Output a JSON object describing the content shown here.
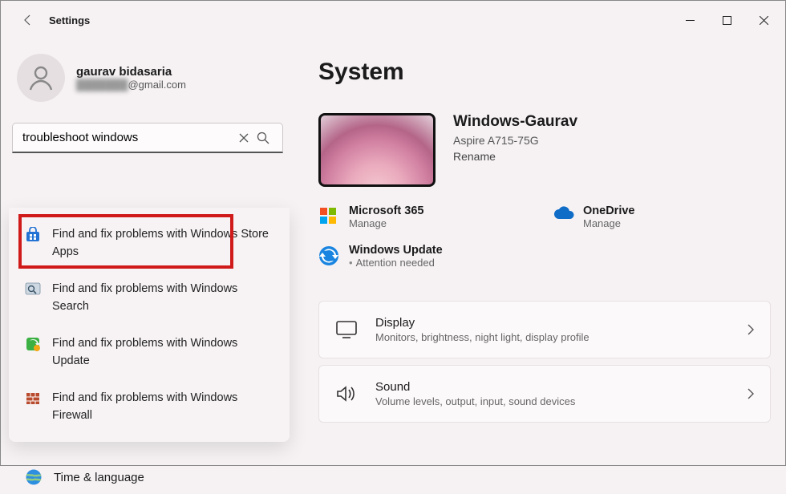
{
  "app_title": "Settings",
  "account": {
    "name": "gaurav bidasaria",
    "email_hidden": "███████",
    "email_domain": "@gmail.com"
  },
  "search": {
    "value": "troubleshoot windows"
  },
  "suggestions": [
    {
      "icon": "store-icon",
      "label": "Find and fix problems with Windows Store Apps"
    },
    {
      "icon": "search-fix-icon",
      "label": "Find and fix problems with Windows Search"
    },
    {
      "icon": "wu-fix-icon",
      "label": "Find and fix problems with Windows Update"
    },
    {
      "icon": "firewall-icon",
      "label": "Find and fix problems with Windows Firewall"
    }
  ],
  "nav_peek": {
    "icon": "globe-icon",
    "label": "Time & language"
  },
  "main": {
    "page_title": "System",
    "device": {
      "name": "Windows-Gaurav",
      "model": "Aspire A715-75G",
      "rename": "Rename"
    },
    "quick": {
      "m365": {
        "label": "Microsoft 365",
        "sub": "Manage"
      },
      "onedrive": {
        "label": "OneDrive",
        "sub": "Manage"
      },
      "wu": {
        "label": "Windows Update",
        "sub": "Attention needed"
      }
    },
    "cards": {
      "display": {
        "label": "Display",
        "sub": "Monitors, brightness, night light, display profile"
      },
      "sound": {
        "label": "Sound",
        "sub": "Volume levels, output, input, sound devices"
      }
    }
  }
}
